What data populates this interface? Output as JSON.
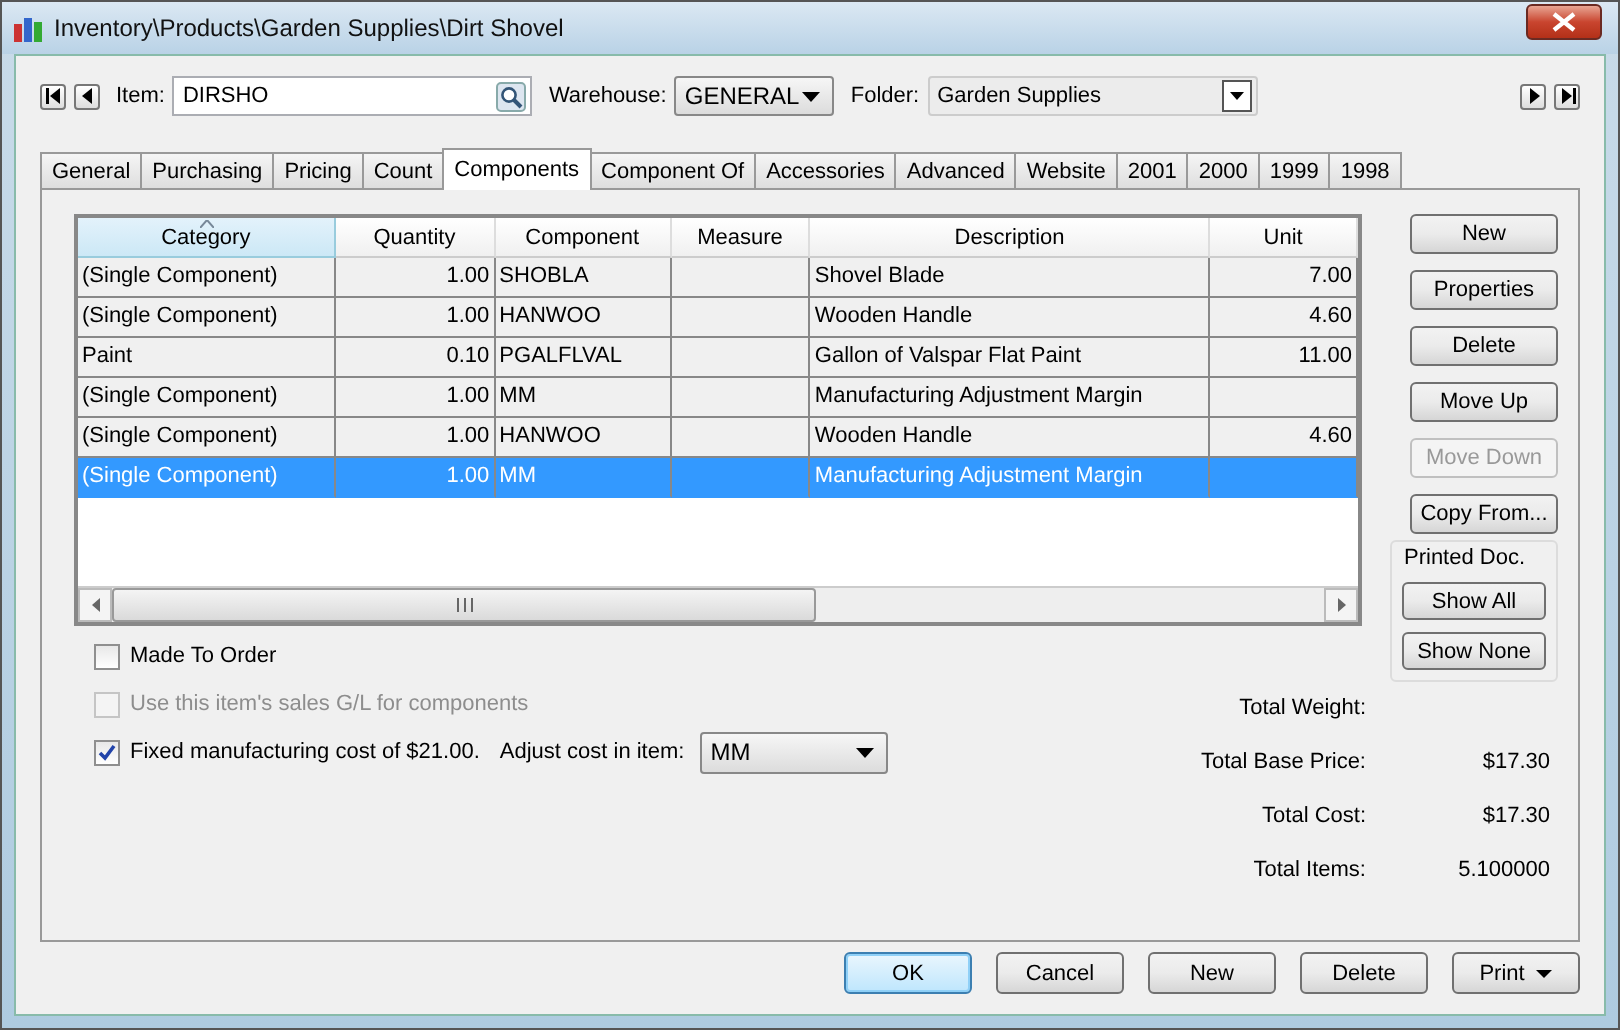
{
  "window": {
    "title": "Inventory\\Products\\Garden Supplies\\Dirt Shovel"
  },
  "item_bar": {
    "item_label": "Item:",
    "item_value": "DIRSHO",
    "warehouse_label": "Warehouse:",
    "warehouse_value": "GENERAL",
    "folder_label": "Folder:",
    "folder_value": "Garden Supplies"
  },
  "tabs": [
    {
      "label": "General",
      "selected": false
    },
    {
      "label": "Purchasing",
      "selected": false
    },
    {
      "label": "Pricing",
      "selected": false
    },
    {
      "label": "Count",
      "selected": false
    },
    {
      "label": "Components",
      "selected": true
    },
    {
      "label": "Component Of",
      "selected": false
    },
    {
      "label": "Accessories",
      "selected": false
    },
    {
      "label": "Advanced",
      "selected": false
    },
    {
      "label": "Website",
      "selected": false
    },
    {
      "label": "2001",
      "selected": false
    },
    {
      "label": "2000",
      "selected": false
    },
    {
      "label": "1999",
      "selected": false
    },
    {
      "label": "1998",
      "selected": false
    }
  ],
  "grid": {
    "columns": [
      {
        "label": "Category",
        "numeric": false,
        "sorted": true
      },
      {
        "label": "Quantity",
        "numeric": true,
        "sorted": false
      },
      {
        "label": "Component",
        "numeric": false,
        "sorted": false
      },
      {
        "label": "Measure",
        "sorted": false
      },
      {
        "label": "Description",
        "numeric": false,
        "sorted": false
      },
      {
        "label": "Unit",
        "numeric": true,
        "sorted": false
      }
    ],
    "rows": [
      {
        "cells": [
          "(Single Component)",
          "1.00",
          "SHOBLA",
          "",
          "Shovel Blade",
          "7.00"
        ],
        "selected": false
      },
      {
        "cells": [
          "(Single Component)",
          "1.00",
          "HANWOO",
          "",
          "Wooden Handle",
          "4.60"
        ],
        "selected": false
      },
      {
        "cells": [
          "Paint",
          "0.10",
          "PGALFLVAL",
          "",
          "Gallon of Valspar Flat Paint",
          "11.00"
        ],
        "selected": false
      },
      {
        "cells": [
          "(Single Component)",
          "1.00",
          "MM",
          "",
          "Manufacturing Adjustment Margin",
          ""
        ],
        "selected": false
      },
      {
        "cells": [
          "(Single Component)",
          "1.00",
          "HANWOO",
          "",
          "Wooden Handle",
          "4.60"
        ],
        "selected": false
      },
      {
        "cells": [
          "(Single Component)",
          "1.00",
          "MM",
          "",
          "Manufacturing Adjustment Margin",
          ""
        ],
        "selected": true
      }
    ]
  },
  "side_buttons": [
    {
      "label": "New",
      "disabled": false
    },
    {
      "label": "Properties",
      "disabled": false
    },
    {
      "label": "Delete",
      "disabled": false
    },
    {
      "label": "Move Up",
      "disabled": false
    },
    {
      "label": "Move Down",
      "disabled": true
    },
    {
      "label": "Copy From...",
      "disabled": false
    }
  ],
  "printed_doc": {
    "title": "Printed Doc.",
    "buttons": [
      "Show All",
      "Show None"
    ]
  },
  "options": [
    {
      "label": "Made To Order",
      "checked": false,
      "disabled": false
    },
    {
      "label": "Use this item's sales G/L for components",
      "checked": false,
      "disabled": true
    },
    {
      "label": "Fixed manufacturing cost of $21.00.",
      "checked": true,
      "disabled": false,
      "adjust_label": "Adjust cost in item:",
      "adjust_value": "MM"
    }
  ],
  "totals": [
    {
      "label": "Total Weight:"
    },
    {
      "label": "Total Base Price:",
      "value": "$17.30"
    },
    {
      "label": "Total Cost:",
      "value": "$17.30"
    },
    {
      "label": "Total Items:",
      "value": "5.100000"
    }
  ],
  "footer_buttons": [
    {
      "label": "OK",
      "default": true,
      "menu": false
    },
    {
      "label": "Cancel",
      "default": false,
      "menu": false
    },
    {
      "label": "New",
      "default": false,
      "menu": false
    },
    {
      "label": "Delete",
      "default": false,
      "menu": false
    },
    {
      "label": "Print",
      "default": false,
      "menu": true
    }
  ]
}
